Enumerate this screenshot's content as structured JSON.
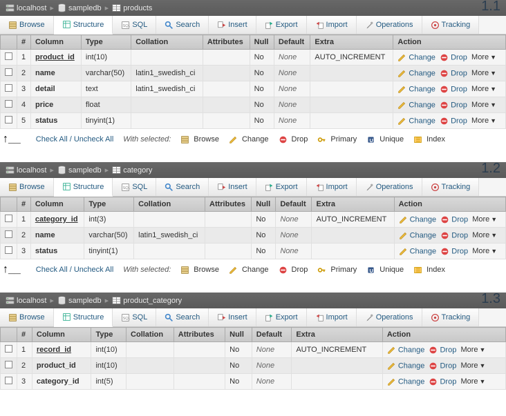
{
  "panels": [
    {
      "version": "1.1",
      "breadcrumb": [
        "localhost",
        "sampledb",
        "products"
      ],
      "columns": [
        {
          "n": "1",
          "name": "product_id",
          "pk": true,
          "type": "int(10)",
          "coll": "",
          "attr": "",
          "null": "No",
          "def": "None",
          "extra": "AUTO_INCREMENT"
        },
        {
          "n": "2",
          "name": "name",
          "pk": false,
          "type": "varchar(50)",
          "coll": "latin1_swedish_ci",
          "attr": "",
          "null": "No",
          "def": "None",
          "extra": ""
        },
        {
          "n": "3",
          "name": "detail",
          "pk": false,
          "type": "text",
          "coll": "latin1_swedish_ci",
          "attr": "",
          "null": "No",
          "def": "None",
          "extra": ""
        },
        {
          "n": "4",
          "name": "price",
          "pk": false,
          "type": "float",
          "coll": "",
          "attr": "",
          "null": "No",
          "def": "None",
          "extra": ""
        },
        {
          "n": "5",
          "name": "status",
          "pk": false,
          "type": "tinyint(1)",
          "coll": "",
          "attr": "",
          "null": "No",
          "def": "None",
          "extra": ""
        }
      ]
    },
    {
      "version": "1.2",
      "breadcrumb": [
        "localhost",
        "sampledb",
        "category"
      ],
      "columns": [
        {
          "n": "1",
          "name": "category_id",
          "pk": true,
          "type": "int(3)",
          "coll": "",
          "attr": "",
          "null": "No",
          "def": "None",
          "extra": "AUTO_INCREMENT"
        },
        {
          "n": "2",
          "name": "name",
          "pk": false,
          "type": "varchar(50)",
          "coll": "latin1_swedish_ci",
          "attr": "",
          "null": "No",
          "def": "None",
          "extra": ""
        },
        {
          "n": "3",
          "name": "status",
          "pk": false,
          "type": "tinyint(1)",
          "coll": "",
          "attr": "",
          "null": "No",
          "def": "None",
          "extra": ""
        }
      ]
    },
    {
      "version": "1.3",
      "breadcrumb": [
        "localhost",
        "sampledb",
        "product_category"
      ],
      "no_footer": true,
      "columns": [
        {
          "n": "1",
          "name": "record_id",
          "pk": true,
          "type": "int(10)",
          "coll": "",
          "attr": "",
          "null": "No",
          "def": "None",
          "extra": "AUTO_INCREMENT"
        },
        {
          "n": "2",
          "name": "product_id",
          "pk": false,
          "type": "int(10)",
          "coll": "",
          "attr": "",
          "null": "No",
          "def": "None",
          "extra": ""
        },
        {
          "n": "3",
          "name": "category_id",
          "pk": false,
          "type": "int(5)",
          "coll": "",
          "attr": "",
          "null": "No",
          "def": "None",
          "extra": ""
        }
      ]
    }
  ],
  "tabs": [
    {
      "key": "browse",
      "label": "Browse"
    },
    {
      "key": "structure",
      "label": "Structure",
      "active": true
    },
    {
      "key": "sql",
      "label": "SQL"
    },
    {
      "key": "search",
      "label": "Search"
    },
    {
      "key": "insert",
      "label": "Insert"
    },
    {
      "key": "export",
      "label": "Export"
    },
    {
      "key": "import",
      "label": "Import"
    },
    {
      "key": "operations",
      "label": "Operations"
    },
    {
      "key": "tracking",
      "label": "Tracking"
    }
  ],
  "headers": [
    "#",
    "Column",
    "Type",
    "Collation",
    "Attributes",
    "Null",
    "Default",
    "Extra",
    "Action"
  ],
  "actions": {
    "change": "Change",
    "drop": "Drop",
    "more": "More"
  },
  "footer": {
    "checkall": "Check All / Uncheck All",
    "withsel": "With selected:",
    "items": [
      "Browse",
      "Change",
      "Drop",
      "Primary",
      "Unique",
      "Index"
    ]
  }
}
